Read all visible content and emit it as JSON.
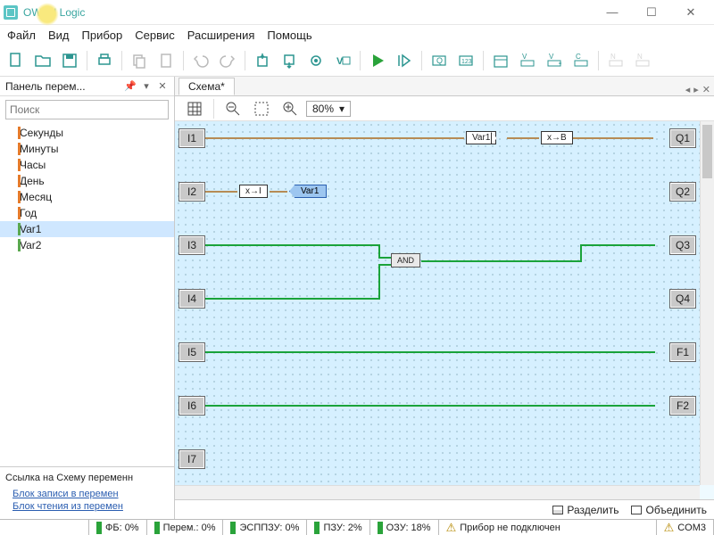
{
  "title": "OWEN Logic",
  "menu": {
    "file": "Файл",
    "view": "Вид",
    "device": "Прибор",
    "service": "Сервис",
    "extensions": "Расширения",
    "help": "Помощь"
  },
  "panel": {
    "title": "Панель перем...",
    "search_placeholder": "Поиск",
    "vars": [
      {
        "label": "Секунды",
        "cls": ""
      },
      {
        "label": "Минуты",
        "cls": ""
      },
      {
        "label": "Часы",
        "cls": ""
      },
      {
        "label": "День",
        "cls": ""
      },
      {
        "label": "Месяц",
        "cls": ""
      },
      {
        "label": "Год",
        "cls": ""
      },
      {
        "label": "Var1",
        "cls": "green sel"
      },
      {
        "label": "Var2",
        "cls": "green"
      }
    ],
    "links_header": "Ссылка на Схему переменн",
    "link1": "Блок записи в перемен",
    "link2": "Блок чтения из перемен"
  },
  "tab": "Схема*",
  "zoom": "80%",
  "io": {
    "inputs": [
      "I1",
      "I2",
      "I3",
      "I4",
      "I5",
      "I6",
      "I7"
    ],
    "outputs": [
      "Q1",
      "Q2",
      "Q3",
      "Q4",
      "F1",
      "F2"
    ]
  },
  "blocks": {
    "xi": "x→I",
    "var1": "Var1",
    "var1b": "Var1",
    "xb": "x→B",
    "and": "AND"
  },
  "split": {
    "split": "Разделить",
    "merge": "Объединить"
  },
  "status": {
    "fb": "ФБ: 0%",
    "perem": "Перем.: 0%",
    "esp": "ЭСППЗУ: 0%",
    "pzu": "ПЗУ: 2%",
    "ozu": "ОЗУ: 18%",
    "device": "Прибор не подключен",
    "com": "COM3"
  }
}
